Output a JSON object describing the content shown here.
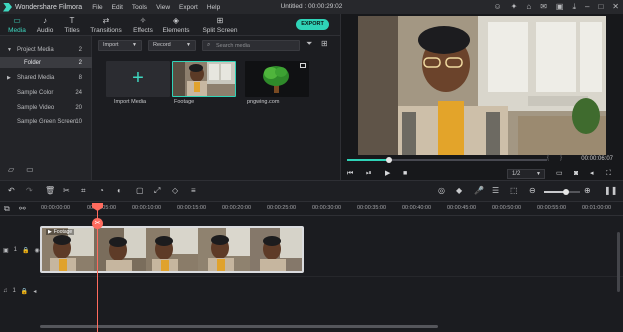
{
  "app": {
    "name": "Wondershare Filmora",
    "menu": [
      "File",
      "Edit",
      "Tools",
      "View",
      "Export",
      "Help"
    ],
    "project_title": "Untitled : 00:00:29:02",
    "window_icons": [
      "user-icon",
      "gift-icon",
      "store-icon",
      "mail-icon",
      "save-icon",
      "download-icon",
      "minimize-icon",
      "maximize-icon",
      "close-icon"
    ]
  },
  "tabs": [
    {
      "label": "Media",
      "icon": "folder-icon",
      "active": true
    },
    {
      "label": "Audio",
      "icon": "music-icon",
      "active": false
    },
    {
      "label": "Titles",
      "icon": "text-icon",
      "active": false
    },
    {
      "label": "Transitions",
      "icon": "transition-icon",
      "active": false
    },
    {
      "label": "Effects",
      "icon": "effects-icon",
      "active": false
    },
    {
      "label": "Elements",
      "icon": "elements-icon",
      "active": false
    },
    {
      "label": "Split Screen",
      "icon": "split-screen-icon",
      "active": false
    }
  ],
  "export_label": "EXPORT",
  "sidebar": {
    "items": [
      {
        "label": "Project Media",
        "count": "2",
        "expand": "▼",
        "selected": false
      },
      {
        "label": "Folder",
        "count": "2",
        "expand": "",
        "selected": true
      },
      {
        "label": "Shared Media",
        "count": "8",
        "expand": "▶",
        "selected": false
      },
      {
        "label": "Sample Color",
        "count": "24",
        "expand": "",
        "selected": false
      },
      {
        "label": "Sample Video",
        "count": "20",
        "expand": "",
        "selected": false
      },
      {
        "label": "Sample Green Screen",
        "count": "10",
        "expand": "",
        "selected": false
      }
    ]
  },
  "media": {
    "import_dropdown": "Import",
    "record_dropdown": "Record",
    "search_placeholder": "Search media",
    "items": [
      {
        "caption": "Import Media"
      },
      {
        "caption": "Footage"
      },
      {
        "caption": "pngwing.com"
      }
    ]
  },
  "preview": {
    "timecode": "00:00:06:07",
    "mark_in": "{",
    "mark_out": "}",
    "ratio": "1/2",
    "progress": 0.21
  },
  "timeline": {
    "ticks": [
      "00:00:00:00",
      "00:00:05:00",
      "00:00:10:00",
      "00:00:15:00",
      "00:00:20:00",
      "00:00:25:00",
      "00:00:30:00",
      "00:00:35:00",
      "00:00:40:00",
      "00:00:45:00",
      "00:00:50:00",
      "00:00:55:00",
      "00:01:00:00"
    ],
    "clip_name": "Footage",
    "video_track_label": "1",
    "audio_track_label": "1",
    "zoom_level": 0.6
  },
  "colors": {
    "accent": "#2fd3b7",
    "playhead": "#ff6b5e"
  }
}
